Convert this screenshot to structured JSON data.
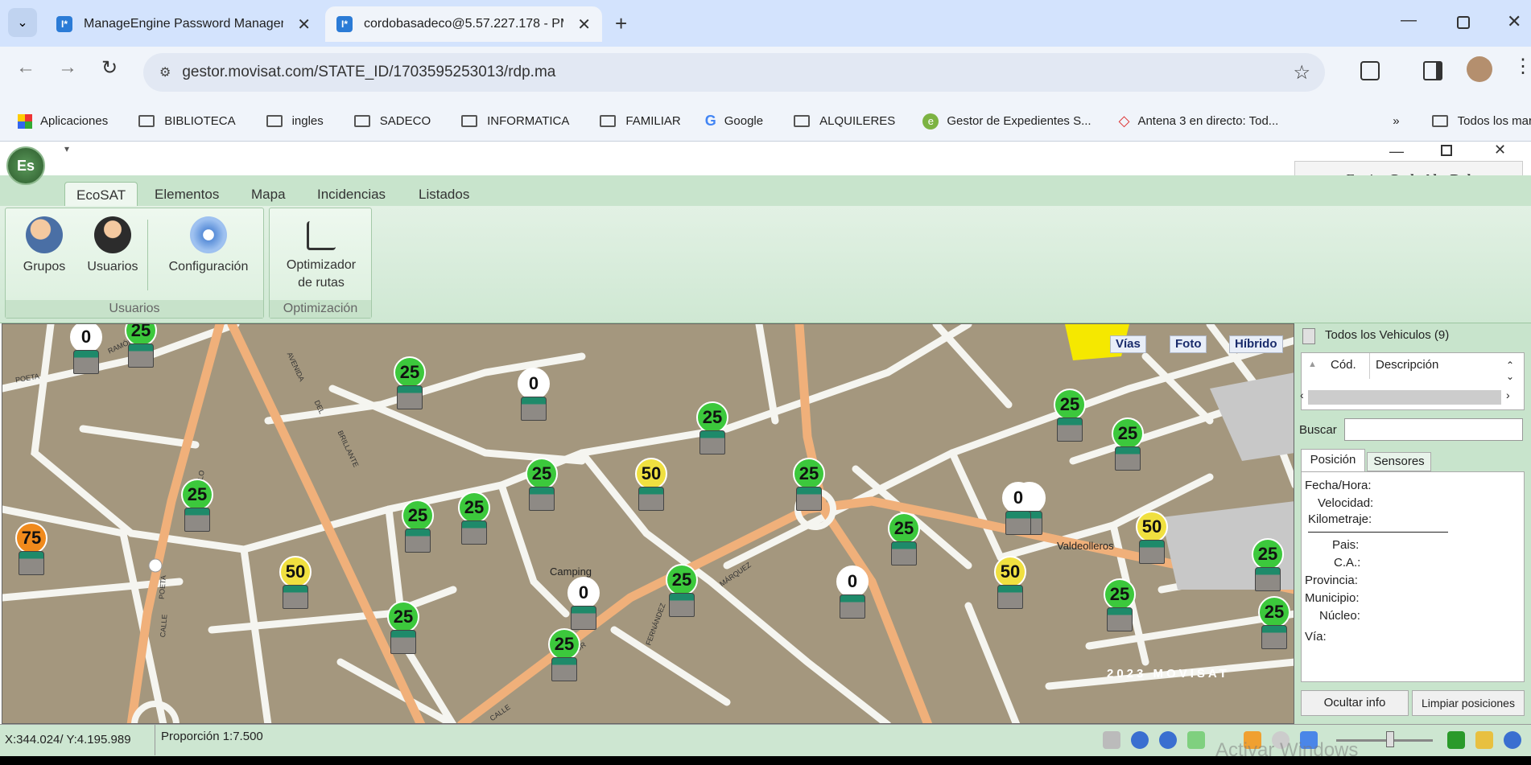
{
  "browser": {
    "tabs": [
      {
        "title": "ManageEngine Password Manager Pro",
        "favicon": "I*"
      },
      {
        "title": "cordobasadeco@5.57.227.178 - PMP",
        "favicon": "I*"
      }
    ],
    "url": "gestor.movisat.com/STATE_ID/1703595253013/rdp.ma",
    "bookmarks": [
      "Aplicaciones",
      "BIBLIOTECA",
      "ingles",
      "SADECO",
      "INFORMATICA",
      "FAMILIAR",
      "Google",
      "ALQUILERES",
      "Gestor de Expedientes S...",
      "Antena 3 en directo: Tod..."
    ],
    "all_bookmarks": "Todos los marcadores"
  },
  "rdp": {
    "send_label": "Enviar",
    "send_keys": "Ctrl+Alt+Del"
  },
  "app": {
    "logo": "Es",
    "ribbon_tabs": [
      "EcoSAT",
      "Elementos",
      "Mapa",
      "Incidencias",
      "Listados"
    ],
    "groups": {
      "usuarios": {
        "caption": "Usuarios",
        "buttons": [
          "Grupos",
          "Usuarios",
          "Configuración"
        ]
      },
      "optimizacion": {
        "caption": "Optimización",
        "button_line1": "Optimizador",
        "button_line2": "de rutas"
      }
    }
  },
  "map": {
    "buttons": [
      "Vías",
      "Foto",
      "Híbrido"
    ],
    "labels": [
      "Camping",
      "Valdeolleros",
      "POETA",
      "RAMÓN",
      "AVENIDA",
      "DEL",
      "BRILLANTE",
      "CALLE",
      "POETA",
      "ESCULTOR",
      "FERNÁNDEZ",
      "MÁRQUEZ",
      "CALLE",
      "ÁNILO"
    ],
    "watermark": "2023 MOVISAT",
    "markers": [
      {
        "value": "0",
        "color": "#ffffff"
      },
      {
        "value": "25",
        "color": "#3cc83c"
      },
      {
        "value": "25",
        "color": "#3cc83c"
      },
      {
        "value": "0",
        "color": "#ffffff"
      },
      {
        "value": "25",
        "color": "#3cc83c"
      },
      {
        "value": "25",
        "color": "#3cc83c"
      },
      {
        "value": "25",
        "color": "#3cc83c"
      },
      {
        "value": "50",
        "color": "#f0e040"
      },
      {
        "value": "25",
        "color": "#3cc83c"
      },
      {
        "value": "25",
        "color": "#3cc83c"
      },
      {
        "value": "25",
        "color": "#3cc83c"
      },
      {
        "value": "0",
        "color": "#ffffff"
      },
      {
        "value": "25",
        "color": "#3cc83c"
      },
      {
        "value": "50",
        "color": "#f0e040"
      },
      {
        "value": "75",
        "color": "#f08a1c"
      },
      {
        "value": "50",
        "color": "#f0e040"
      },
      {
        "value": "25",
        "color": "#3cc83c"
      },
      {
        "value": "0",
        "color": "#ffffff"
      },
      {
        "value": "25",
        "color": "#3cc83c"
      },
      {
        "value": "0",
        "color": "#ffffff"
      },
      {
        "value": "0",
        "color": "#ffffff"
      },
      {
        "value": "50",
        "color": "#f0e040"
      },
      {
        "value": "25",
        "color": "#3cc83c"
      },
      {
        "value": "25",
        "color": "#3cc83c"
      },
      {
        "value": "25",
        "color": "#3cc83c"
      },
      {
        "value": "25",
        "color": "#3cc83c"
      },
      {
        "value": "25",
        "color": "#3cc83c"
      },
      {
        "value": "25",
        "color": "#3cc83c"
      }
    ]
  },
  "panel": {
    "title": "Todos los Vehiculos (9)",
    "col_code": "Cód.",
    "col_desc": "Descripción",
    "search_label": "Buscar",
    "search_value": "",
    "tabs": [
      "Posición",
      "Sensores"
    ],
    "fields": [
      "Fecha/Hora:",
      "Velocidad:",
      "Kilometraje:",
      "Pais:",
      "C.A.:",
      "Provincia:",
      "Municipio:",
      "Núcleo:",
      "Vía:"
    ],
    "btn_hide": "Ocultar info",
    "btn_clear": "Limpiar posiciones"
  },
  "status": {
    "coords": "X:344.024/ Y:4.195.989",
    "scale": "Proporción 1:7.500",
    "windows_watermark": "Activar Windows"
  }
}
